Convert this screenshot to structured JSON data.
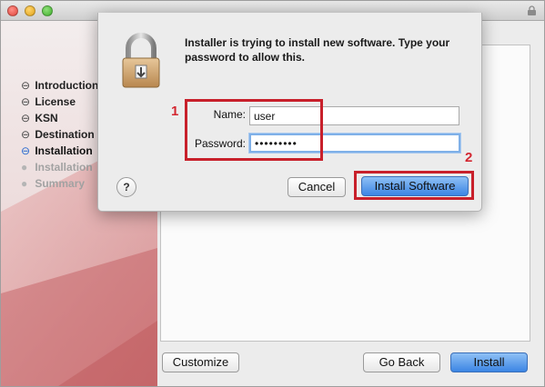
{
  "window": {
    "steps": [
      {
        "label": "Introduction",
        "state": "done"
      },
      {
        "label": "License",
        "state": "done"
      },
      {
        "label": "KSN",
        "state": "done"
      },
      {
        "label": "Destination",
        "state": "done"
      },
      {
        "label": "Installation",
        "state": "current"
      },
      {
        "label": "Installation",
        "state": "pending"
      },
      {
        "label": "Summary",
        "state": "pending"
      }
    ],
    "buttons": {
      "customize": "Customize",
      "go_back": "Go Back",
      "install": "Install"
    }
  },
  "dialog": {
    "message": "Installer is trying to install new software. Type your password to allow this.",
    "name_label": "Name:",
    "name_value": "user",
    "password_label": "Password:",
    "password_value": "•••••••••",
    "help_label": "?",
    "cancel_label": "Cancel",
    "install_software_label": "Install Software"
  },
  "annotations": {
    "marker_1": "1",
    "marker_2": "2"
  },
  "icons": {
    "step_done_icon": "⊖",
    "step_current_icon": "⊖",
    "step_pending_icon": "●"
  },
  "colors": {
    "accent_blue": "#3b85e4",
    "annotation_red": "#c8202b",
    "backdrop_pink": "#d98a8a"
  }
}
